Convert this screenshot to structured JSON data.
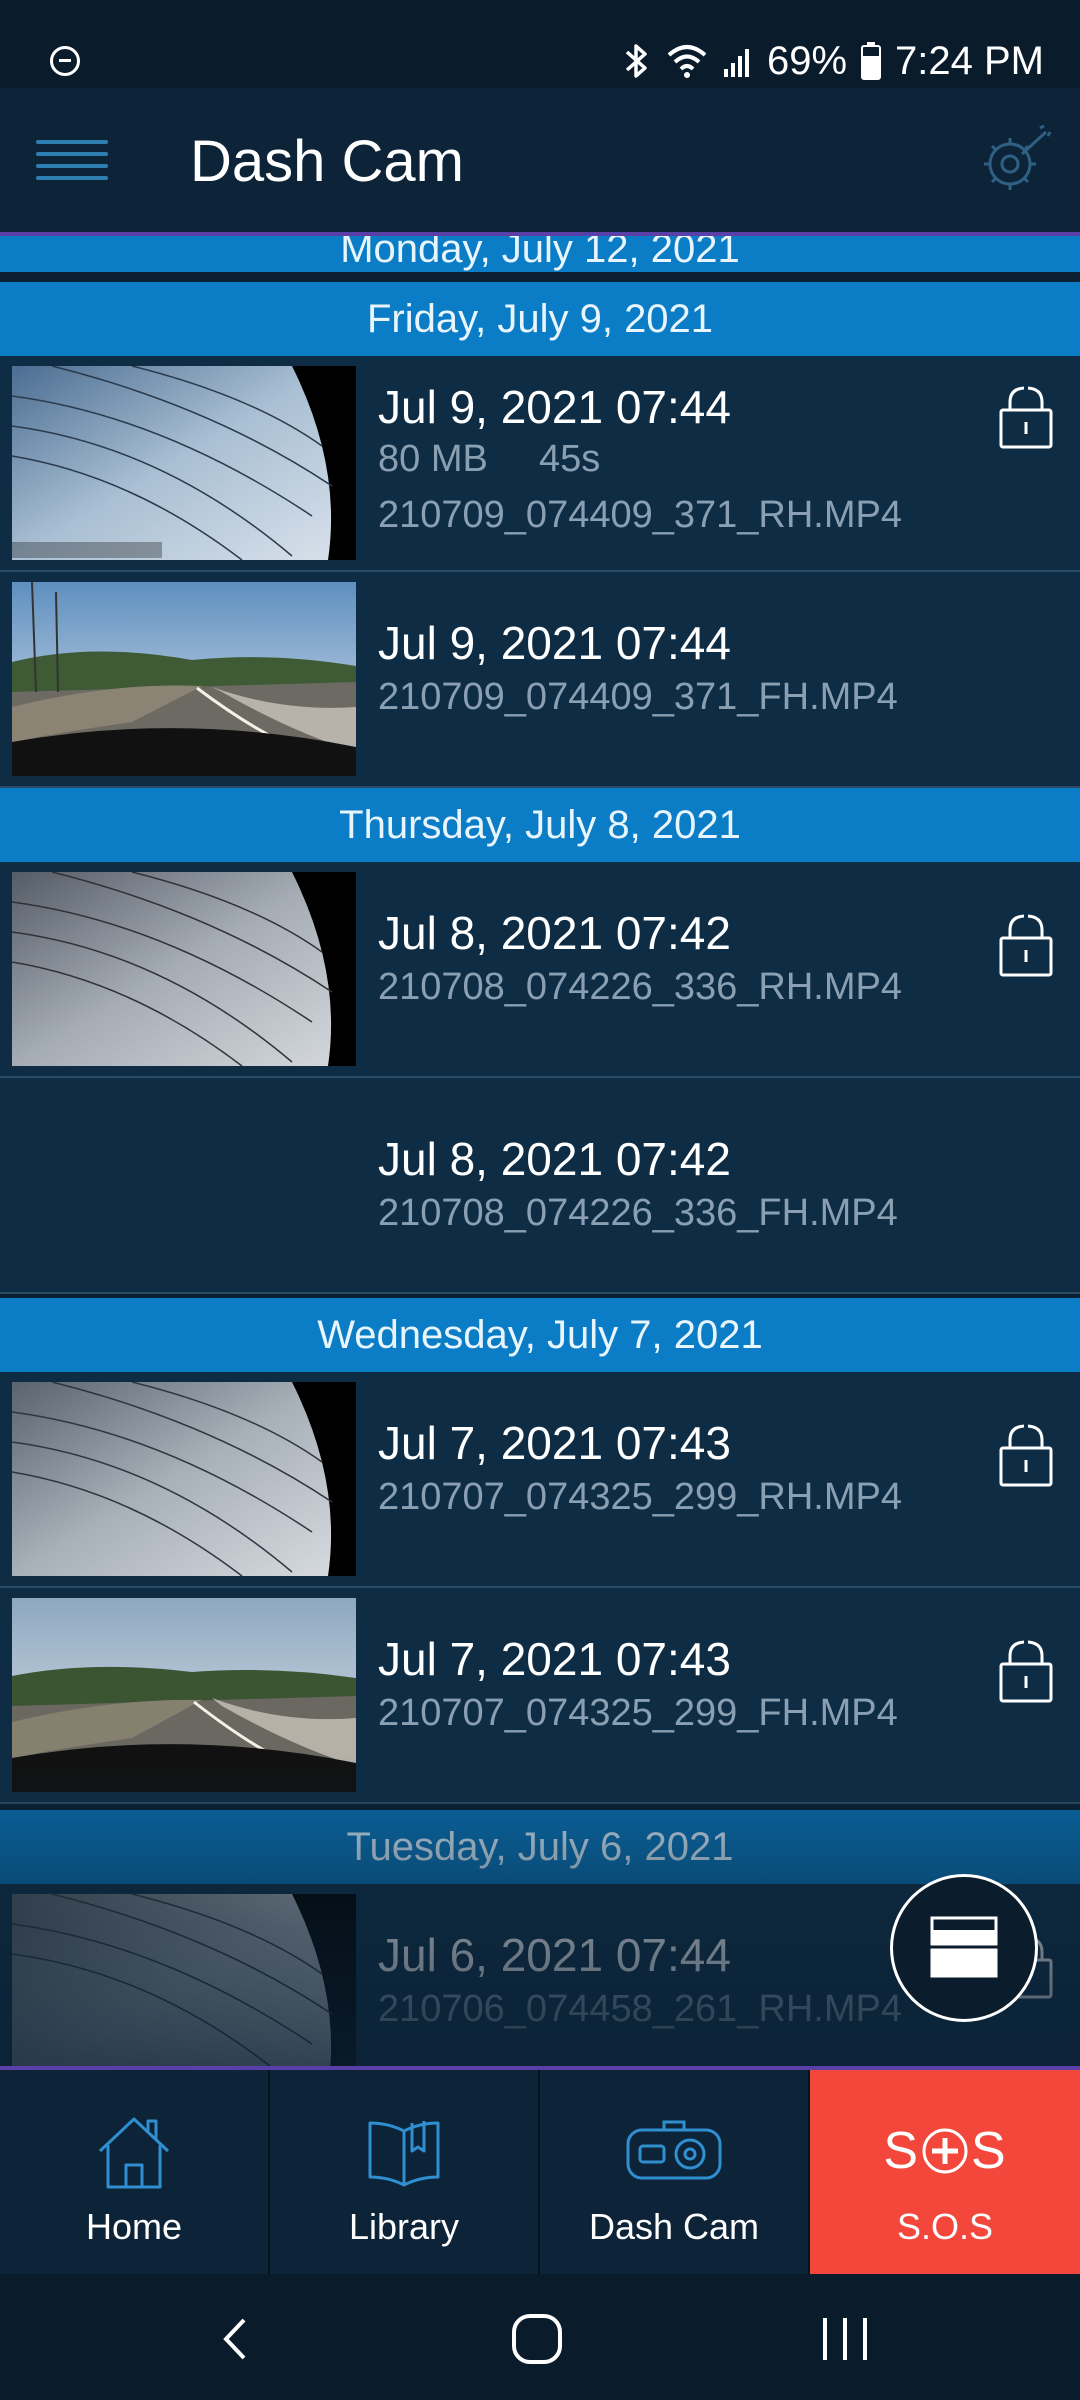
{
  "status_bar": {
    "battery": "69%",
    "time": "7:24 PM"
  },
  "app_bar": {
    "title": "Dash Cam"
  },
  "sections": [
    {
      "label": "Monday, July 12, 2021"
    },
    {
      "label": "Friday, July 9, 2021"
    },
    {
      "label": "Thursday, July 8, 2021"
    },
    {
      "label": "Wednesday, July 7, 2021"
    },
    {
      "label": "Tuesday, July 6, 2021"
    }
  ],
  "recordings": [
    {
      "datetime": "Jul 9, 2021 07:44",
      "size": "80 MB",
      "duration": "45s",
      "filename": "210709_074409_371_RH.MP4",
      "thumbnail": "rear-window",
      "locked": true
    },
    {
      "datetime": "Jul 9, 2021 07:44",
      "filename": "210709_074409_371_FH.MP4",
      "thumbnail": "front-road",
      "locked": false
    },
    {
      "datetime": "Jul 8, 2021 07:42",
      "filename": "210708_074226_336_RH.MP4",
      "thumbnail": "rear-window",
      "locked": true
    },
    {
      "datetime": "Jul 8, 2021 07:42",
      "filename": "210708_074226_336_FH.MP4",
      "thumbnail": "none",
      "locked": false
    },
    {
      "datetime": "Jul 7, 2021 07:43",
      "filename": "210707_074325_299_RH.MP4",
      "thumbnail": "rear-window",
      "locked": true
    },
    {
      "datetime": "Jul 7, 2021 07:43",
      "filename": "210707_074325_299_FH.MP4",
      "thumbnail": "front-road",
      "locked": true
    },
    {
      "datetime": "Jul 6, 2021 07:44",
      "filename": "210706_074458_261_RH.MP4",
      "thumbnail": "rear-window",
      "locked": true
    }
  ],
  "bottom_nav": [
    {
      "label": "Home",
      "icon": "house-icon"
    },
    {
      "label": "Library",
      "icon": "book-icon"
    },
    {
      "label": "Dash Cam",
      "icon": "dashcam-icon"
    },
    {
      "label": "S.O.S",
      "icon": "sos-icon"
    }
  ],
  "sos_mark": {
    "left": "S",
    "right": "S"
  },
  "colors": {
    "section_header": "#0b7dc6",
    "row": "#0e2d45",
    "sos": "#f3473b",
    "accent_line": "#5a3fa8"
  }
}
